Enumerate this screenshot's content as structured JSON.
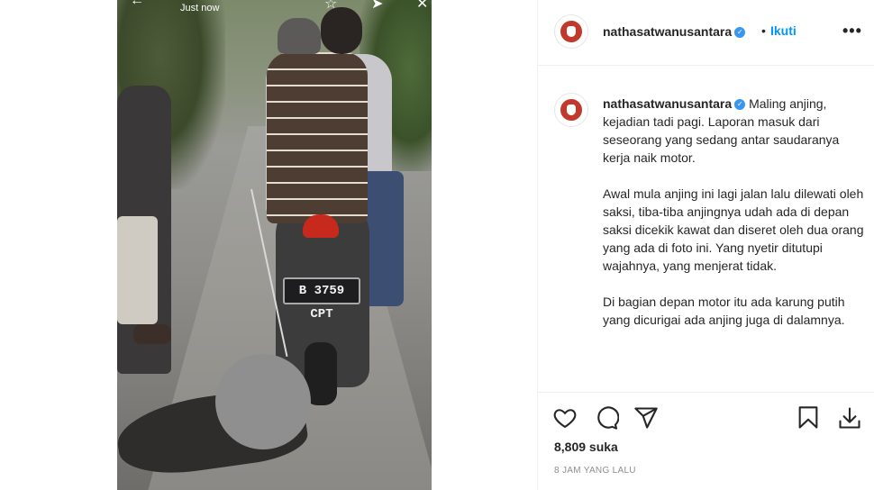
{
  "story": {
    "timestamp": "Just now",
    "plate_text": "B 3759 CPT"
  },
  "header": {
    "username": "nathasatwanusantara",
    "separator": "•",
    "follow_label": "Ikuti",
    "more_label": "•••"
  },
  "caption": {
    "username": "nathasatwanusantara",
    "paragraph_1": "Maling anjing, kejadian tadi pagi. Laporan masuk dari seseorang yang sedang antar saudaranya kerja naik motor.",
    "paragraph_2": "Awal mula anjing ini lagi jalan lalu dilewati oleh saksi, tiba-tiba anjingnya udah ada di depan saksi dicekik kawat dan diseret oleh dua orang yang ada di foto ini. Yang nyetir ditutupi wajahnya, yang menjerat tidak.",
    "paragraph_3": "Di bagian depan motor itu ada karung putih yang dicurigai ada anjing juga di dalamnya."
  },
  "actions": {
    "icons": [
      "heart-icon",
      "comment-icon",
      "share-icon",
      "bookmark-icon",
      "download-icon"
    ],
    "likes_text": "8,809 suka",
    "time_text": "8 JAM YANG LALU"
  },
  "colors": {
    "link_blue": "#0095f6",
    "verified_blue": "#3897f0",
    "text": "#262626",
    "muted": "#8e8e8e"
  }
}
